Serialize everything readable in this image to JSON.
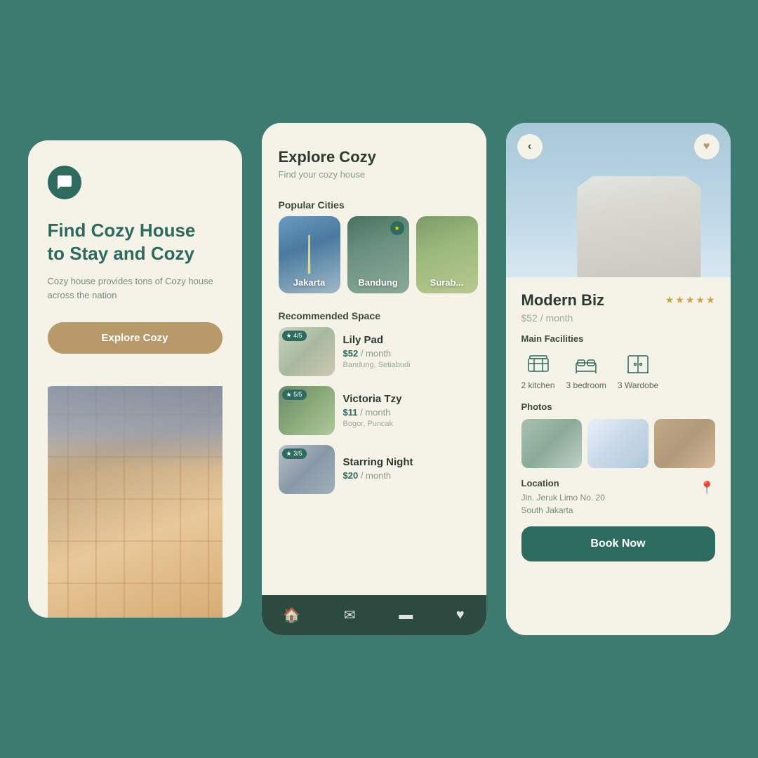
{
  "screen1": {
    "logo_alt": "cozy-logo",
    "title_line1": "Find Cozy House",
    "title_line2": "to Stay and Cozy",
    "description": "Cozy house provides tons of Cozy house across the nation",
    "button_label": "Explore Cozy"
  },
  "screen2": {
    "title": "Explore Cozy",
    "subtitle": "Find your cozy house",
    "popular_cities_label": "Popular Cities",
    "cities": [
      {
        "name": "Jakarta",
        "style": "jakarta"
      },
      {
        "name": "Bandung",
        "style": "bandung",
        "starred": true
      },
      {
        "name": "Surabaya",
        "style": "surabaya"
      }
    ],
    "recommended_label": "Recommended Space",
    "spaces": [
      {
        "name": "Lily Pad",
        "rating": "4/5",
        "price": "$52",
        "unit": "month",
        "location": "Bandung, Setiabudi",
        "img_style": "1"
      },
      {
        "name": "Victoria Tzy",
        "rating": "5/5",
        "price": "$11",
        "unit": "month",
        "location": "Bogor, Puncak",
        "img_style": "2"
      },
      {
        "name": "Starring Night",
        "rating": "3/5",
        "price": "$20",
        "unit": "month",
        "location": "",
        "img_style": "3"
      }
    ],
    "navbar": {
      "home": "🏠",
      "mail": "✉",
      "card": "💳",
      "heart": "♥"
    }
  },
  "screen3": {
    "property_name": "Modern Biz",
    "price": "$52",
    "price_unit": "month",
    "stars": 5,
    "facilities_label": "Main Facilities",
    "facilities": [
      {
        "name": "kitchen",
        "count": "2",
        "label": "kitchen"
      },
      {
        "name": "bedroom",
        "count": "3",
        "label": "bedroom"
      },
      {
        "name": "wardrobe",
        "count": "3",
        "label": "Wardobe"
      }
    ],
    "photos_label": "Photos",
    "location_label": "Location",
    "location_address_line1": "Jln. Jeruk Limo No. 20",
    "location_address_line2": "South Jakarta",
    "book_button_label": "Book Now",
    "back_icon": "‹",
    "heart_icon": "♥"
  }
}
